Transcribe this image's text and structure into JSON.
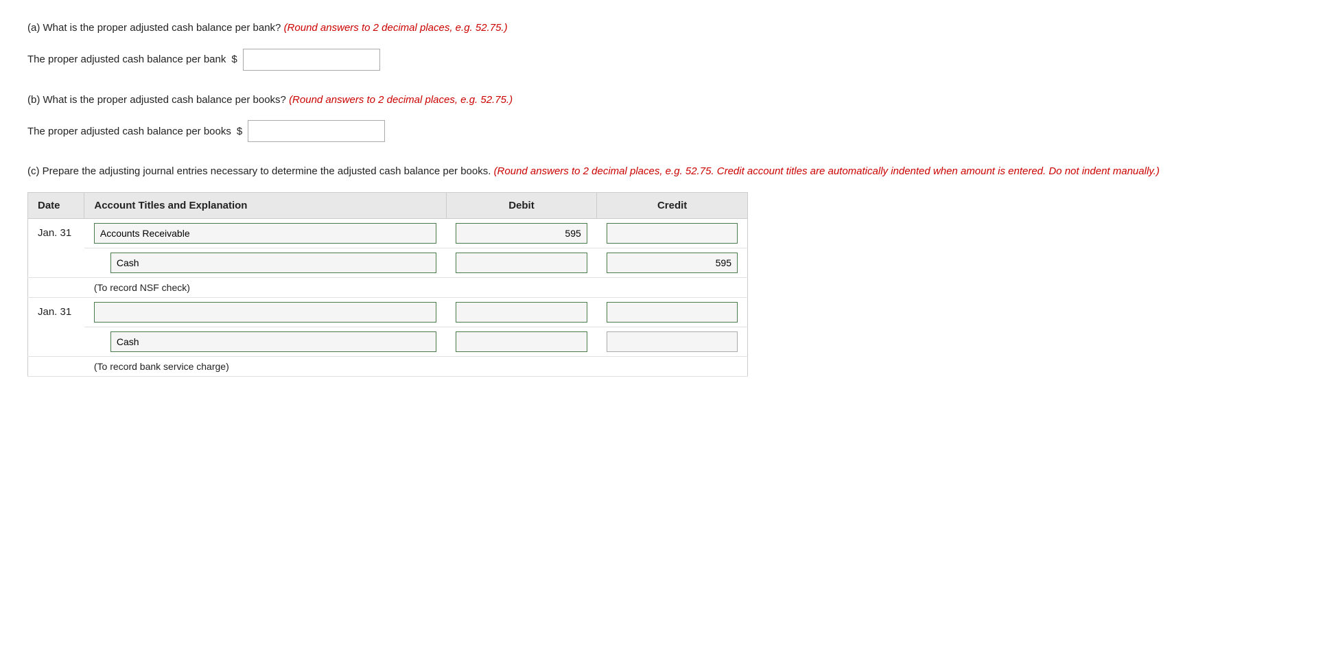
{
  "section_a": {
    "question": "(a) What is the proper adjusted cash balance per bank?",
    "hint": "(Round answers to 2 decimal places, e.g. 52.75.)",
    "label": "The proper adjusted cash balance per bank",
    "dollar": "$",
    "value": ""
  },
  "section_b": {
    "question": "(b) What is the proper adjusted cash balance per books?",
    "hint": "(Round answers to 2 decimal places, e.g. 52.75.)",
    "label": "The proper adjusted cash balance per books",
    "dollar": "$",
    "value": ""
  },
  "section_c": {
    "question": "(c) Prepare the adjusting journal entries necessary to determine the adjusted cash balance per books.",
    "hint": "(Round answers to 2 decimal places, e.g. 52.75. Credit account titles are automatically indented when amount is entered. Do not indent manually.)",
    "table": {
      "headers": [
        "Date",
        "Account Titles and Explanation",
        "Debit",
        "Credit"
      ],
      "entries": [
        {
          "date": "Jan. 31",
          "rows": [
            {
              "account": "Accounts Receivable",
              "indented": false,
              "debit": "595",
              "credit": ""
            },
            {
              "account": "Cash",
              "indented": true,
              "debit": "",
              "credit": "595"
            }
          ],
          "note": "(To record NSF check)"
        },
        {
          "date": "Jan. 31",
          "rows": [
            {
              "account": "",
              "indented": false,
              "debit": "",
              "credit": ""
            },
            {
              "account": "Cash",
              "indented": true,
              "debit": "",
              "credit": ""
            }
          ],
          "note": "(To record bank service charge)"
        }
      ]
    }
  }
}
